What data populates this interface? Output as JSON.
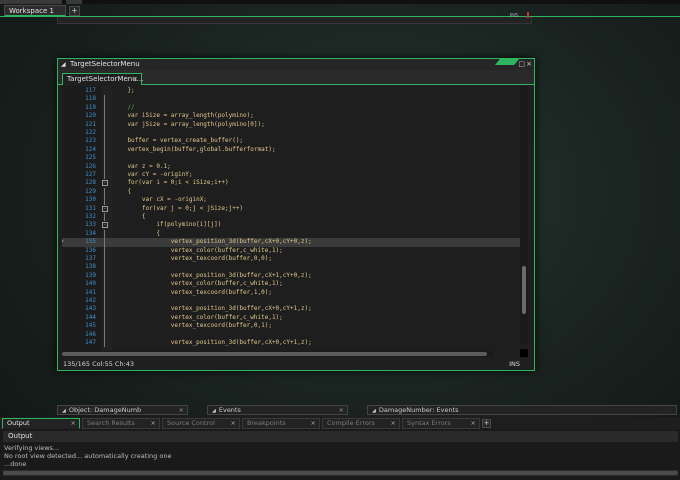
{
  "workspace": {
    "tab_label": "Workspace 1",
    "add_label": "+"
  },
  "bg_window": {
    "status_right": "INS"
  },
  "editor_window": {
    "title": "TargetSelectorMenu",
    "tab_label": "TargetSelectorMenu...",
    "close_glyph": "×",
    "status_position": "135/165 Col:55 Ch:43",
    "status_mode": "INS",
    "lines": [
      {
        "n": "117",
        "t": "    };"
      },
      {
        "n": "118",
        "t": ""
      },
      {
        "n": "119",
        "t": "    //",
        "c": "cmt"
      },
      {
        "n": "120",
        "t": "    var iSize = array_length(polymino);"
      },
      {
        "n": "121",
        "t": "    var jSize = array_length(polymino[0]);"
      },
      {
        "n": "122",
        "t": ""
      },
      {
        "n": "123",
        "t": "    buffer = vertex_create_buffer();"
      },
      {
        "n": "124",
        "t": "    vertex_begin(buffer,global.bufferformat);"
      },
      {
        "n": "125",
        "t": ""
      },
      {
        "n": "126",
        "t": "    var z = 0.1;"
      },
      {
        "n": "127",
        "t": "    var cY = -originY;"
      },
      {
        "n": "128",
        "t": "    for(var i = 0;i < iSize;i++)",
        "f": "-"
      },
      {
        "n": "129",
        "t": "    {"
      },
      {
        "n": "130",
        "t": "        var cX = -originX;"
      },
      {
        "n": "131",
        "t": "        for(var j = 0;j < jSize;j++)",
        "f": "-"
      },
      {
        "n": "132",
        "t": "        {"
      },
      {
        "n": "133",
        "t": "            if(polymino[i][j])",
        "f": "-"
      },
      {
        "n": "134",
        "t": "            {"
      },
      {
        "n": "135",
        "t": "                vertex_position_3d(buffer,cX+0,cY+0,z);",
        "cur": true
      },
      {
        "n": "136",
        "t": "                vertex_color(buffer,c_white,1);"
      },
      {
        "n": "137",
        "t": "                vertex_texcoord(buffer,0,0);"
      },
      {
        "n": "138",
        "t": ""
      },
      {
        "n": "139",
        "t": "                vertex_position_3d(buffer,cX+1,cY+0,z);"
      },
      {
        "n": "140",
        "t": "                vertex_color(buffer,c_white,1);"
      },
      {
        "n": "141",
        "t": "                vertex_texcoord(buffer,1,0);"
      },
      {
        "n": "142",
        "t": ""
      },
      {
        "n": "143",
        "t": "                vertex_position_3d(buffer,cX+0,cY+1,z);"
      },
      {
        "n": "144",
        "t": "                vertex_color(buffer,c_white,1);"
      },
      {
        "n": "145",
        "t": "                vertex_texcoord(buffer,0,1);"
      },
      {
        "n": "146",
        "t": ""
      },
      {
        "n": "147",
        "t": "                vertex_position_3d(buffer,cX+0,cY+1,z);"
      }
    ]
  },
  "dock_tabs": [
    {
      "label": "Object: DamageNumb"
    },
    {
      "label": "Events"
    },
    {
      "label": "DamageNumber: Events"
    }
  ],
  "bottom_panel": {
    "tabs": [
      {
        "label": "Output",
        "active": true
      },
      {
        "label": "Search Results"
      },
      {
        "label": "Source Control"
      },
      {
        "label": "Breakpoints"
      },
      {
        "label": "Compile Errors"
      },
      {
        "label": "Syntax Errors"
      }
    ],
    "add_label": "+",
    "header": "Output",
    "lines": [
      "Verifying views...",
      "No root view detected... automatically creating one",
      "...done"
    ]
  },
  "colors": {
    "accent": "#2eb55f",
    "line_numbers": "#3e8fc7",
    "code": "#e3c98b",
    "comment": "#56b04d"
  }
}
